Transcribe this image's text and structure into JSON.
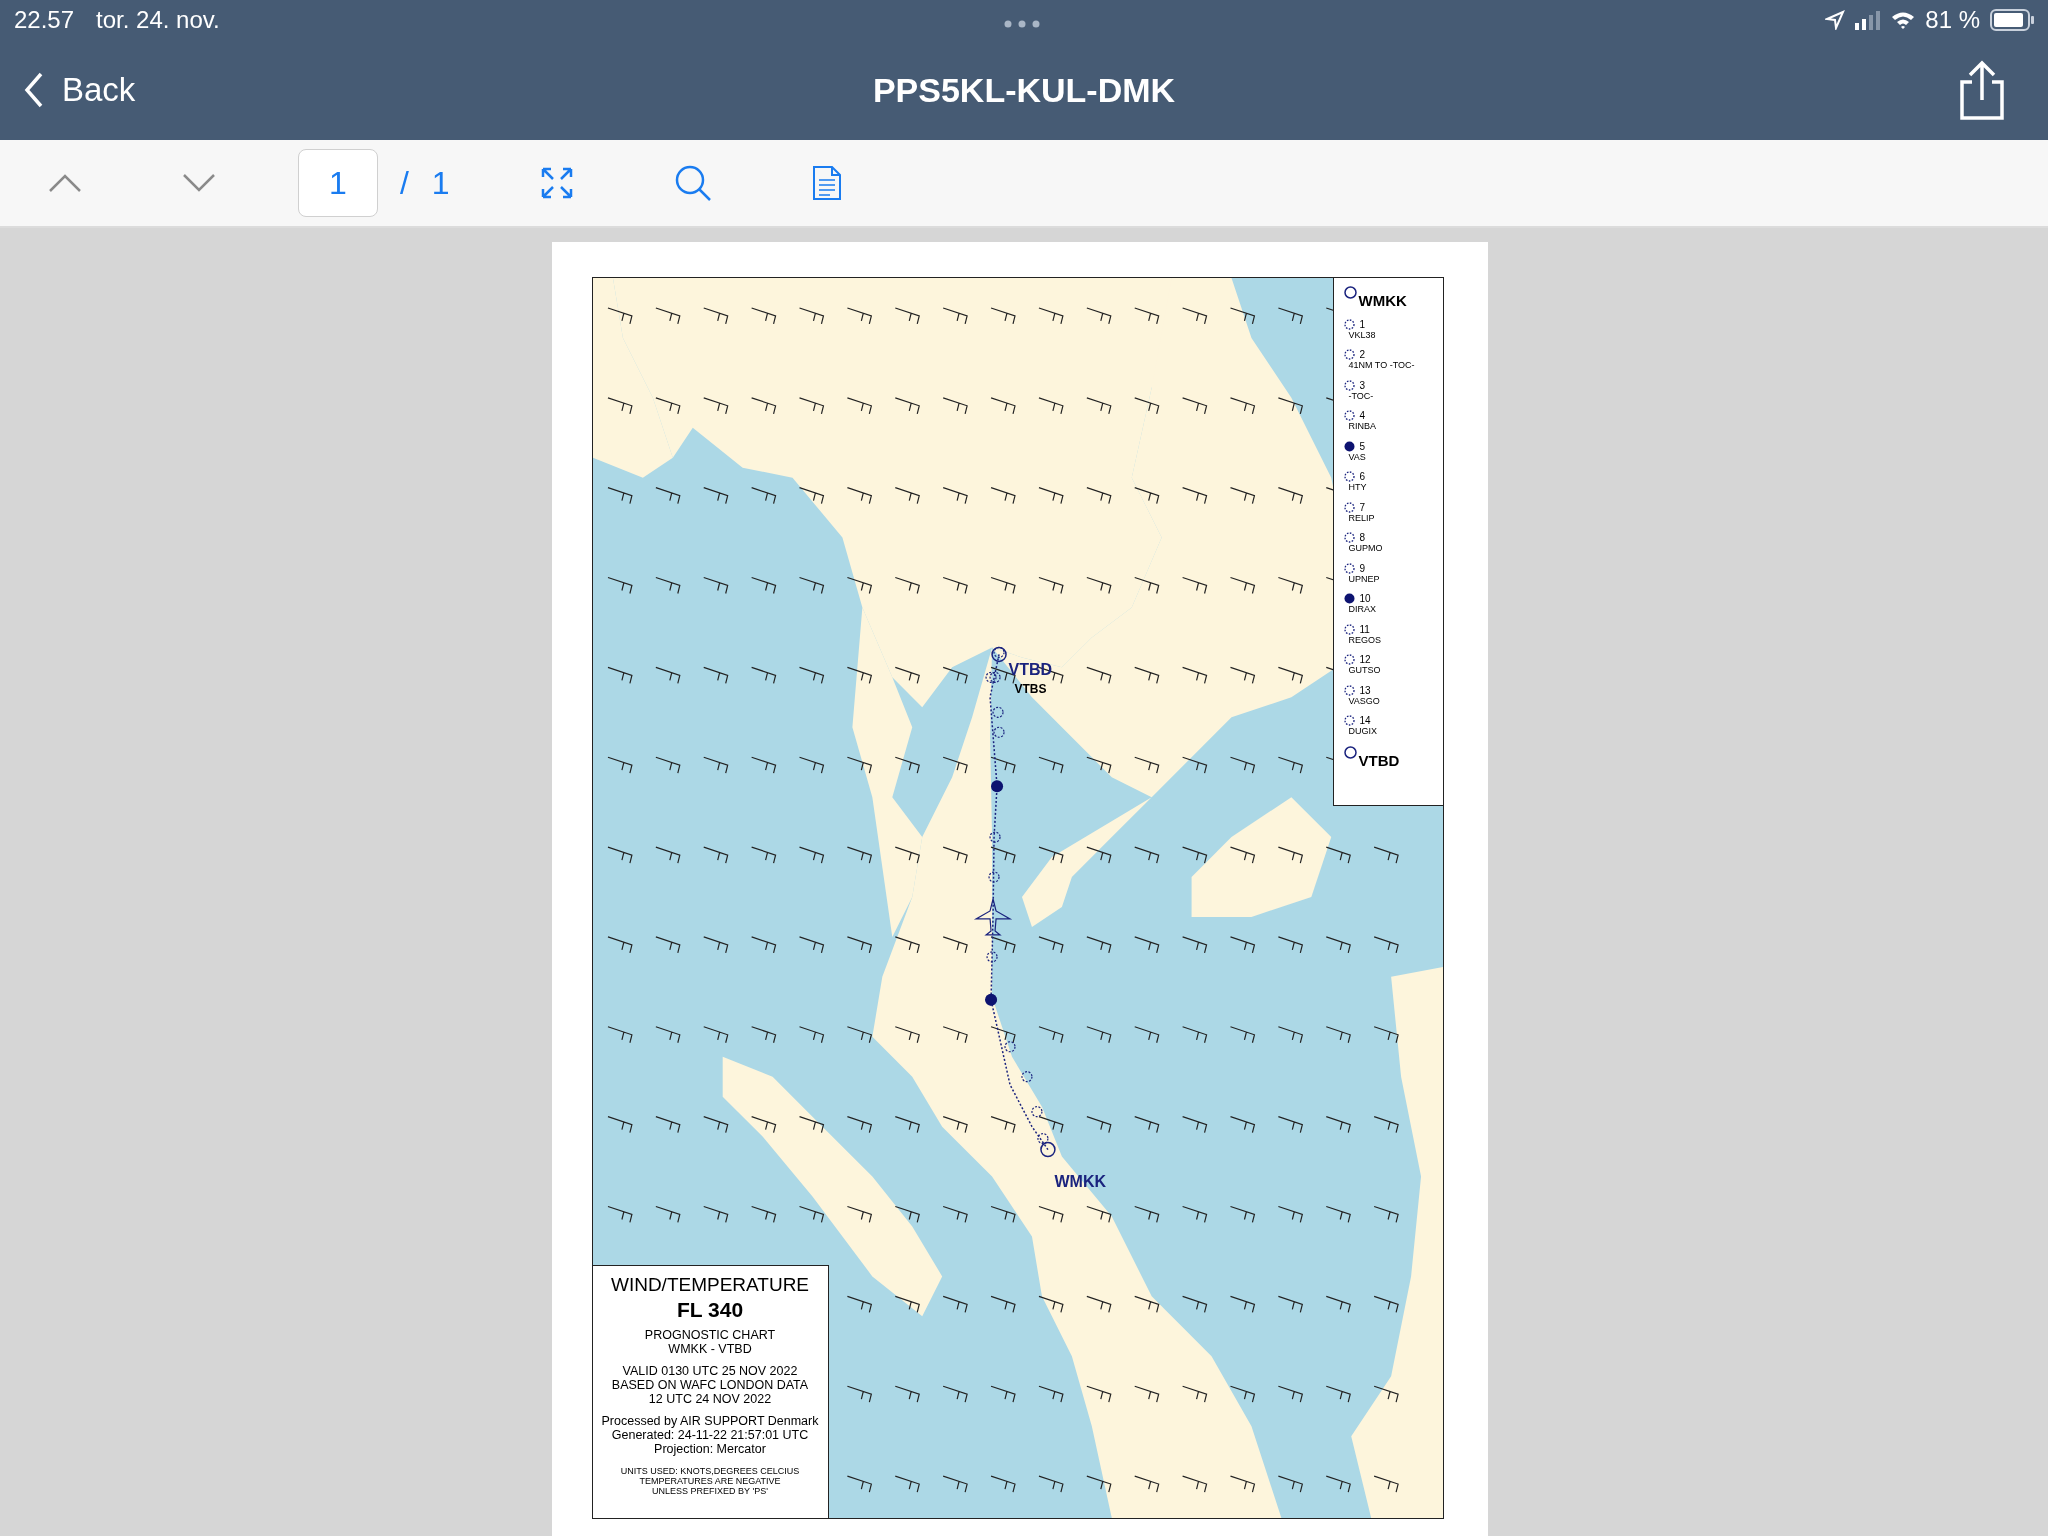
{
  "status_bar": {
    "time": "22.57",
    "date": "tor. 24. nov.",
    "battery": "81 %"
  },
  "nav_bar": {
    "back": "Back",
    "title": "PPS5KL-KUL-DMK"
  },
  "toolbar": {
    "page_field": "1",
    "page_total": "/ 1"
  },
  "chart": {
    "airport_labels": [
      {
        "text": "VTBD",
        "kind": "route"
      },
      {
        "text": "VTBS",
        "kind": "plain"
      },
      {
        "text": "WMKK",
        "kind": "route"
      }
    ],
    "legend": {
      "origin": "WMKK",
      "destination": "VTBD",
      "waypoints": [
        {
          "number": "1",
          "name": "VKL38",
          "kind": "dotted"
        },
        {
          "number": "2",
          "name": "41NM TO -TOC-",
          "kind": "dotted"
        },
        {
          "number": "3",
          "name": "-TOC-",
          "kind": "dotted"
        },
        {
          "number": "4",
          "name": "RINBA",
          "kind": "dotted"
        },
        {
          "number": "5",
          "name": "VAS",
          "kind": "filled"
        },
        {
          "number": "6",
          "name": "HTY",
          "kind": "dotted"
        },
        {
          "number": "7",
          "name": "RELIP",
          "kind": "dotted"
        },
        {
          "number": "8",
          "name": "GUPMO",
          "kind": "dotted"
        },
        {
          "number": "9",
          "name": "UPNEP",
          "kind": "dotted"
        },
        {
          "number": "10",
          "name": "DIRAX",
          "kind": "filled"
        },
        {
          "number": "11",
          "name": "REGOS",
          "kind": "dotted"
        },
        {
          "number": "12",
          "name": "GUTSO",
          "kind": "dotted"
        },
        {
          "number": "13",
          "name": "VASGO",
          "kind": "dotted"
        },
        {
          "number": "14",
          "name": "DUGIX",
          "kind": "dotted"
        }
      ]
    },
    "title_box": {
      "heading": "WIND/TEMPERATURE",
      "level": "FL 340",
      "subtitle": [
        "PROGNOSTIC CHART",
        "WMKK - VTBD"
      ],
      "validity": [
        "VALID 0130 UTC 25 NOV 2022",
        "BASED ON WAFC LONDON DATA",
        "12 UTC 24 NOV 2022"
      ],
      "processing": [
        "Processed by AIR SUPPORT Denmark",
        "Generated: 24-11-22 21:57:01  UTC",
        "Projection: Mercator"
      ],
      "units": [
        "UNITS USED: KNOTS,DEGREES CELCIUS",
        "TEMPERATURES ARE NEGATIVE",
        "UNLESS PREFIXED BY 'PS'"
      ]
    }
  }
}
